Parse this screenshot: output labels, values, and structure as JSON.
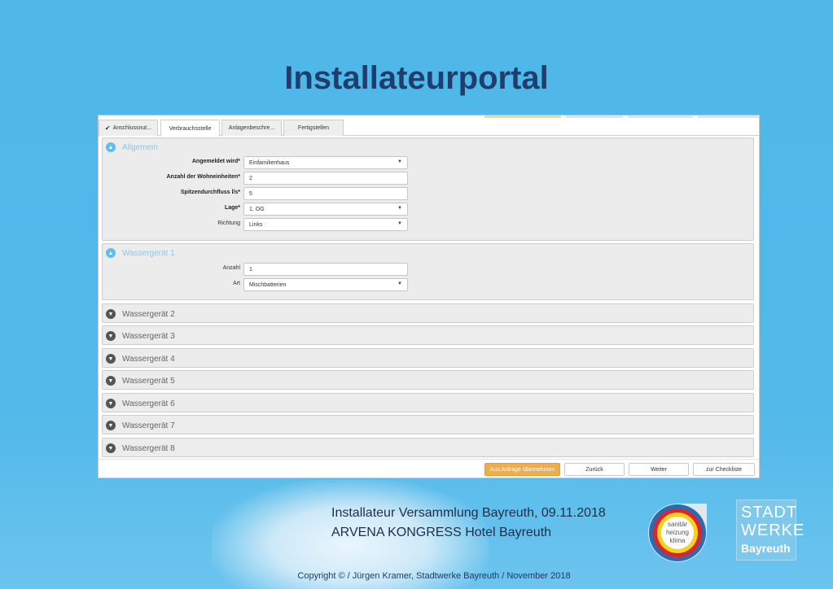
{
  "slide": {
    "title": "Installateurportal",
    "event_line1": "Installateur Versammlung Bayreuth, 09.11.2018",
    "event_line2": "ARVENA KONGRESS Hotel Bayreuth",
    "copyright": "Copyright © / Jürgen Kramer, Stadtwerke Bayreuth / November 2018"
  },
  "tabs": [
    {
      "label": "Anschlussnut...",
      "icon": "check-icon",
      "completed": true
    },
    {
      "label": "Verbrauchsstelle",
      "active": true
    },
    {
      "label": "Anlagenbeschre..."
    },
    {
      "label": "Fertigstellen"
    }
  ],
  "sections": {
    "allgemein": {
      "title": "Allgemein",
      "expanded": true,
      "fields": [
        {
          "label": "Angemeldet wird*",
          "value": "Einfamilienhaus",
          "type": "select",
          "required": true
        },
        {
          "label": "Anzahl der Wohneinheiten*",
          "value": "2",
          "type": "text",
          "required": true
        },
        {
          "label": "Spitzendurchfluss l/s*",
          "value": "5",
          "type": "text",
          "required": true
        },
        {
          "label": "Lage*",
          "value": "1. OG",
          "type": "select",
          "required": true
        },
        {
          "label": "Richtung",
          "value": "Links",
          "type": "select",
          "required": false
        }
      ]
    },
    "wassergeraet1": {
      "title": "Wassergerät 1",
      "expanded": true,
      "fields": [
        {
          "label": "Anzahl",
          "value": "1",
          "type": "text"
        },
        {
          "label": "Art",
          "value": "Mischbatterien",
          "type": "select"
        }
      ]
    },
    "collapsed": [
      {
        "title": "Wassergerät 2"
      },
      {
        "title": "Wassergerät 3"
      },
      {
        "title": "Wassergerät 4"
      },
      {
        "title": "Wassergerät 5"
      },
      {
        "title": "Wassergerät 6"
      },
      {
        "title": "Wassergerät 7"
      },
      {
        "title": "Wassergerät 8"
      }
    ]
  },
  "buttons": {
    "apply": "Aus Anfrage übernehmen",
    "back": "Zurück",
    "next": "Weiter",
    "checklist": "zur Checkliste"
  },
  "logos": {
    "shk": [
      "sanitär",
      "heizung",
      "klima"
    ],
    "stadtwerke": [
      "STADT",
      "WERKE",
      "Bayreuth"
    ]
  },
  "colors": {
    "background": "#52b9ea",
    "title": "#1e3f6e",
    "accent_orange": "#f0ad4e",
    "section_open": "#5bc0ef"
  }
}
